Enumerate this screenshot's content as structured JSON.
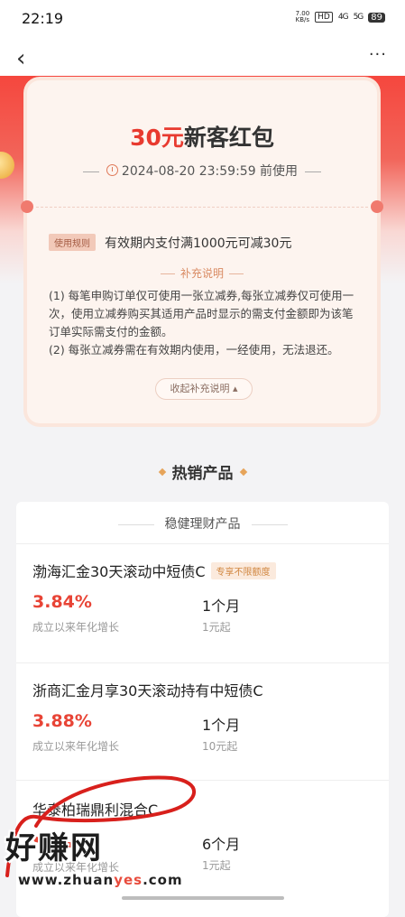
{
  "status_bar": {
    "time": "22:19",
    "net_speed_value": "7.00",
    "net_speed_unit": "KB/s",
    "hd": "HD",
    "sig1": "4G",
    "sig2": "5G",
    "battery": "89"
  },
  "nav": {
    "back_glyph": "‹",
    "more_glyph": "···"
  },
  "coupon": {
    "amount": "30元",
    "title": "新客红包",
    "valid_time": "2024-08-20 23:59:59 前使用",
    "rule_tag": "使用规则",
    "rule_text": "有效期内支付满1000元可减30元",
    "supp_title": "补充说明",
    "supp_line1": "(1) 每笔申购订单仅可使用一张立减券,每张立减券仅可使用一次，使用立减券购买其适用产品时显示的需支付金额即为该笔订单实际需支付的金额。",
    "supp_line2": "(2) 每张立减券需在有效期内使用，一经使用，无法退还。",
    "collapse_label": "收起补充说明"
  },
  "hot": {
    "title": "热销产品"
  },
  "product_list": {
    "header": "稳健理财产品",
    "items": [
      {
        "name": "渤海汇金30天滚动中短债C",
        "badge": "专享不限额度",
        "rate": "3.84%",
        "rate_label": "成立以来年化增长",
        "period": "1个月",
        "min": "1元起"
      },
      {
        "name": "浙商汇金月享30天滚动持有中短债C",
        "badge": "",
        "rate": "3.88%",
        "rate_label": "成立以来年化增长",
        "period": "1个月",
        "min": "10元起"
      },
      {
        "name": "华泰柏瑞鼎利混合C",
        "badge": "",
        "rate": "",
        "rate_label": "成立以来年化增长",
        "period": "6个月",
        "min": "1元起"
      }
    ]
  },
  "watermark": {
    "line1": "好赚网",
    "line2_a": "www.zhuan",
    "line2_b": "yes",
    "line2_c": ".com"
  },
  "colors": {
    "accent": "#e83a2f",
    "coupon_bg": "#fdf4ef",
    "hero": "#f5473e"
  }
}
